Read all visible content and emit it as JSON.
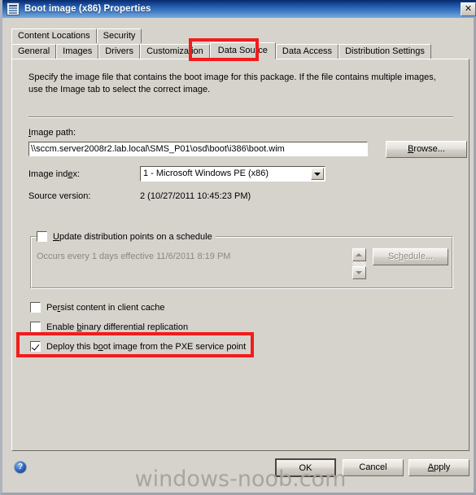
{
  "window": {
    "title": "Boot image (x86) Properties",
    "icon": "properties-document-icon",
    "close_label": "✕"
  },
  "tabs": {
    "row1": [
      {
        "label": "Content Locations",
        "active": false
      },
      {
        "label": "Security",
        "active": false
      }
    ],
    "row2": [
      {
        "label": "General",
        "active": false
      },
      {
        "label": "Images",
        "active": false
      },
      {
        "label": "Drivers",
        "active": false
      },
      {
        "label": "Customization",
        "active": false
      },
      {
        "label": "Data Source",
        "active": true
      },
      {
        "label": "Data Access",
        "active": false
      },
      {
        "label": "Distribution Settings",
        "active": false
      }
    ],
    "selected": "Data Source"
  },
  "page": {
    "description": "Specify the image file that contains the boot image for this package. If the file contains multiple images, use the Image tab to select the correct image.",
    "image_path_label": "Image path:",
    "image_path_value": "\\\\sccm.server2008r2.lab.local\\SMS_P01\\osd\\boot\\i386\\boot.wim",
    "browse_label": "Browse...",
    "image_index_label": "Image index:",
    "image_index_value": "1 - Microsoft Windows PE (x86)",
    "source_version_label": "Source version:",
    "source_version_value": "2 (10/27/2011 10:45:23 PM)",
    "schedule_group": {
      "checkbox_label": "Update distribution points on a schedule",
      "checked": false,
      "occurrence_text": "Occurs every 1 days effective 11/6/2011 8:19 PM",
      "schedule_button_label": "Schedule...",
      "schedule_button_enabled": false
    },
    "checkboxes": [
      {
        "label": "Persist content in client cache",
        "checked": false,
        "highlighted": false
      },
      {
        "label": "Enable binary differential replication",
        "checked": false,
        "highlighted": false
      },
      {
        "label": "Deploy this boot image from the PXE service point",
        "checked": true,
        "highlighted": true
      }
    ]
  },
  "footer": {
    "help_glyph": "?",
    "ok_label": "OK",
    "cancel_label": "Cancel",
    "apply_label": "Apply"
  },
  "watermark": "windows-noob.com",
  "colors": {
    "highlight_red": "#f11c1c",
    "title_bar_blue": "#1b51a3",
    "dialog_face": "#d6d3cd"
  }
}
